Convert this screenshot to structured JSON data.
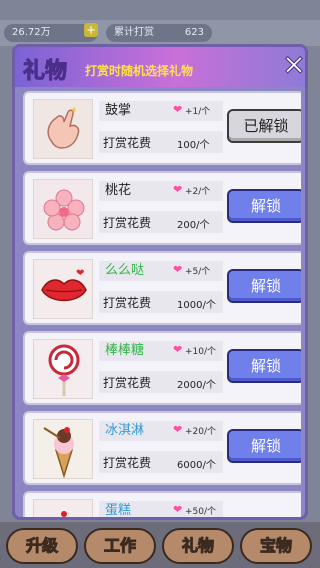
{
  "top": {
    "coins": "26.72万",
    "plus": "+",
    "total_label": "累计打赏",
    "total_value": "623"
  },
  "modal": {
    "title": "礼物",
    "subtitle": "打赏时随机选择礼物",
    "close": "✕"
  },
  "gifts": [
    {
      "name": "鼓掌",
      "name_color": "#222",
      "bonus": "+1/个",
      "cost_label": "打赏花费",
      "cost": "100",
      "unit": "/个",
      "button": "已解锁",
      "unlocked": true
    },
    {
      "name": "桃花",
      "name_color": "#222",
      "bonus": "+2/个",
      "cost_label": "打赏花费",
      "cost": "200",
      "unit": "/个",
      "button": "解锁",
      "unlocked": false
    },
    {
      "name": "么么哒",
      "name_color": "#34b34a",
      "bonus": "+5/个",
      "cost_label": "打赏花费",
      "cost": "1000",
      "unit": "/个",
      "button": "解锁",
      "unlocked": false
    },
    {
      "name": "棒棒糖",
      "name_color": "#34b34a",
      "bonus": "+10/个",
      "cost_label": "打赏花费",
      "cost": "2000",
      "unit": "/个",
      "button": "解锁",
      "unlocked": false
    },
    {
      "name": "冰淇淋",
      "name_color": "#2f9bd6",
      "bonus": "+20/个",
      "cost_label": "打赏花费",
      "cost": "6000",
      "unit": "/个",
      "button": "解锁",
      "unlocked": false
    },
    {
      "name": "蛋糕",
      "name_color": "#2f9bd6",
      "bonus": "+50/个",
      "cost_label": "",
      "cost": "",
      "unit": "",
      "button": "",
      "unlocked": false
    }
  ],
  "bottom": {
    "b1": "升级",
    "b2": "工作",
    "b3": "礼物",
    "b4": "宝物"
  }
}
